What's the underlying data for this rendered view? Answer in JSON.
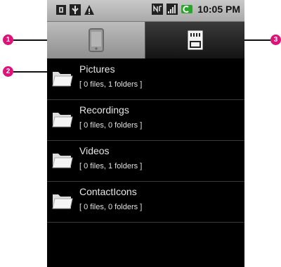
{
  "statusbar": {
    "time": "10:05 PM",
    "icons": [
      "sim-icon",
      "usb-icon",
      "warning-icon",
      "network-icon",
      "signal-icon",
      "battery-icon"
    ]
  },
  "tabs": [
    {
      "name": "tab-phone-storage",
      "icon": "phone-icon",
      "selected": true
    },
    {
      "name": "tab-sd-card",
      "icon": "sdcard-icon",
      "selected": false
    }
  ],
  "folders": [
    {
      "name": "Pictures",
      "meta": "[ 0 files, 1 folders  ]"
    },
    {
      "name": "Recordings",
      "meta": "[ 0 files, 0 folders  ]"
    },
    {
      "name": "Videos",
      "meta": "[ 0 files, 1 folders  ]"
    },
    {
      "name": "ContactIcons",
      "meta": "[ 0 files, 0 folders  ]"
    }
  ],
  "callouts": [
    "1",
    "2",
    "3"
  ],
  "colors": {
    "callout": "#e0127a",
    "battery": "#2aa52a"
  }
}
